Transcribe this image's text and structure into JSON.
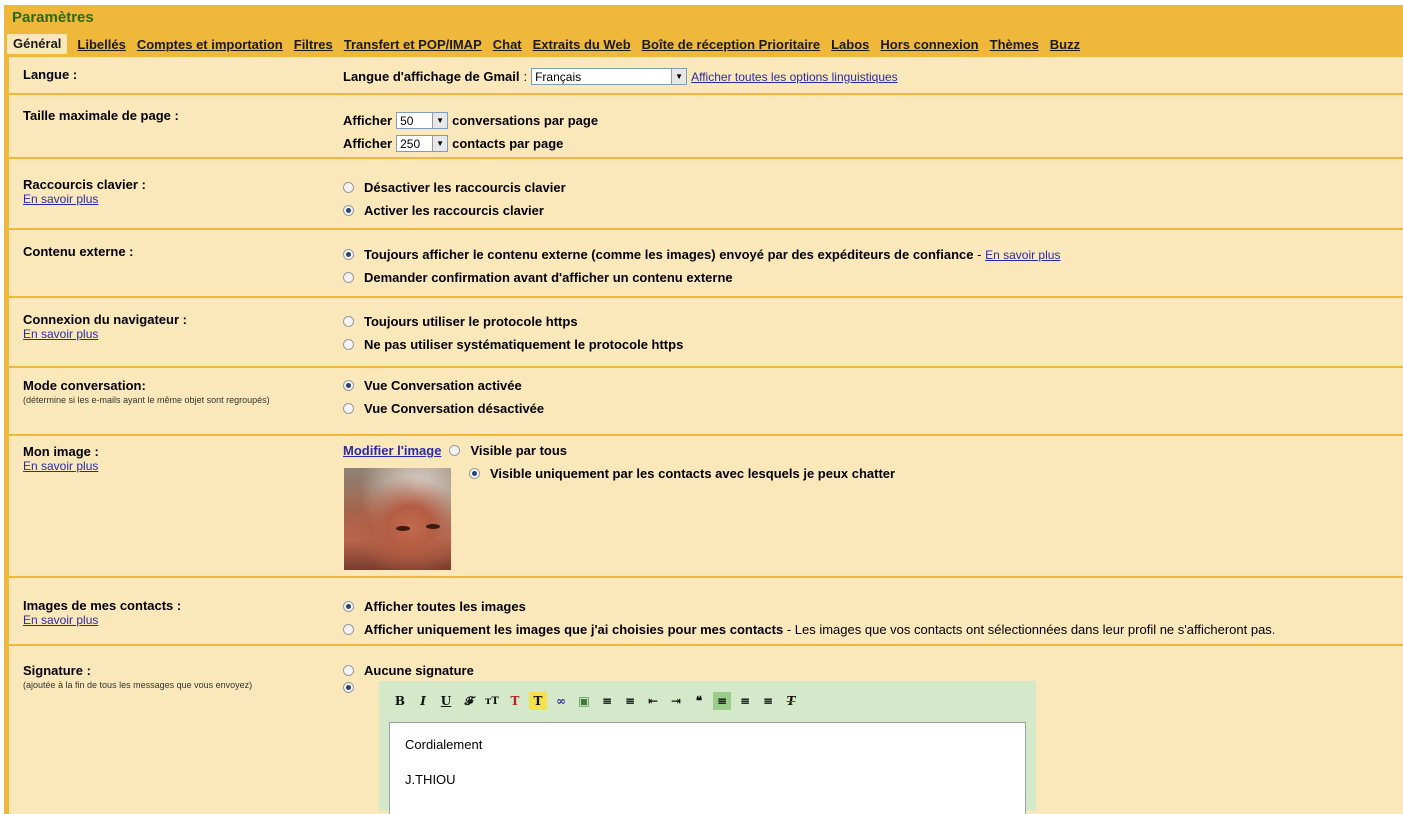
{
  "title": "Paramètres",
  "tabs": [
    "Général",
    "Libellés",
    "Comptes et importation",
    "Filtres",
    "Transfert et POP/IMAP",
    "Chat",
    "Extraits du Web",
    "Boîte de réception Prioritaire",
    "Labos",
    "Hors connexion",
    "Thèmes",
    "Buzz"
  ],
  "active_tab": "Général",
  "language": {
    "label": "Langue :",
    "display_label": "Langue d'affichage de Gmail",
    "colon": ":",
    "selected": "Français",
    "all_options_link": "Afficher toutes les options linguistiques"
  },
  "page_size": {
    "label": "Taille maximale de page :",
    "show": "Afficher",
    "conversations_value": "50",
    "conversations_text": "conversations par page",
    "contacts_value": "250",
    "contacts_text": "contacts par page"
  },
  "shortcuts": {
    "label": "Raccourcis clavier :",
    "learn_more": "En savoir plus",
    "option_off": "Désactiver les raccourcis clavier",
    "option_on": "Activer les raccourcis clavier",
    "selected": "on"
  },
  "external_content": {
    "label": "Contenu externe :",
    "option_always": "Toujours afficher le contenu externe (comme les images) envoyé par des expéditeurs de confiance",
    "dash": " - ",
    "learn_more": "En savoir plus",
    "option_ask": "Demander confirmation avant d'afficher un contenu externe",
    "selected": "always"
  },
  "browser_connection": {
    "label": "Connexion du navigateur :",
    "learn_more": "En savoir plus",
    "option_https": "Toujours utiliser le protocole https",
    "option_no_https": "Ne pas utiliser systématiquement le protocole https",
    "selected": "none"
  },
  "conversation_mode": {
    "label": "Mode conversation:",
    "note": "(détermine si les e-mails ayant le même objet sont regroupés)",
    "option_on": "Vue Conversation activée",
    "option_off": "Vue Conversation désactivée",
    "selected": "on"
  },
  "my_picture": {
    "label": "Mon image :",
    "learn_more": "En savoir plus",
    "change_link": "Modifier l'image",
    "option_all": "Visible par tous",
    "option_contacts": "Visible uniquement par les contacts avec lesquels je peux chatter",
    "selected": "contacts"
  },
  "contact_pictures": {
    "label": "Images de mes contacts :",
    "learn_more": "En savoir plus",
    "option_all": "Afficher toutes les images",
    "option_mine": "Afficher uniquement les images que j'ai choisies pour mes contacts",
    "option_mine_note": " - Les images que vos contacts ont sélectionnées dans leur profil ne s'afficheront pas.",
    "selected": "all"
  },
  "signature": {
    "label": "Signature :",
    "note": "(ajoutée à la fin de tous les messages que vous envoyez)",
    "option_none": "Aucune signature",
    "selected": "custom",
    "toolbar": [
      "B",
      "I",
      "U",
      "𝓕",
      "тT",
      "T",
      "T",
      "∞",
      "▣",
      "≡",
      "≡",
      "⇤",
      "⇥",
      "❝",
      "≡",
      "≡",
      "≡",
      "T"
    ],
    "lines": [
      "Cordialement",
      "J.THIOU"
    ]
  },
  "colors": {
    "frame": "#f0b83a",
    "panel": "#fbe8ba",
    "title": "#2a6a00",
    "link": "#2a2aa8",
    "editor": "#d3e9c9"
  }
}
